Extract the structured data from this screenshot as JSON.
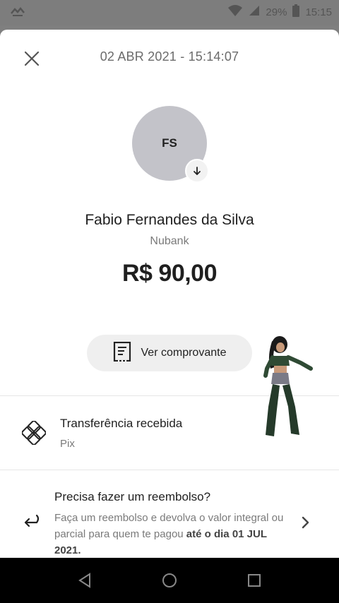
{
  "status_bar": {
    "battery_text": "29%",
    "time": "15:15",
    "icons": [
      "notification-icon",
      "wifi-icon",
      "signal-icon",
      "battery-icon"
    ]
  },
  "header": {
    "datetime": "02 ABR 2021 - 15:14:07",
    "close_icon": "close-icon"
  },
  "contact": {
    "initials": "FS",
    "name": "Fabio Fernandes da Silva",
    "bank": "Nubank",
    "amount": "R$ 90,00",
    "badge_icon": "arrow-down-icon"
  },
  "actions": {
    "receipt_label": "Ver comprovante",
    "receipt_icon": "receipt-icon"
  },
  "transfer": {
    "title": "Transferência recebida",
    "subtitle": "Pix",
    "icon": "pix-icon"
  },
  "refund": {
    "title": "Precisa fazer um reembolso?",
    "body_prefix": "Faça um reembolso e devolva o valor integral ou parcial para quem te pagou ",
    "body_bold": "até o dia 01 JUL 2021.",
    "icon": "return-arrow-icon",
    "chevron_icon": "chevron-right-icon"
  },
  "navigation": {
    "icons": [
      "back-icon",
      "home-icon",
      "recents-icon"
    ]
  },
  "colors": {
    "background_dim": "#7f7f7f",
    "sheet": "#ffffff",
    "avatar": "#c3c3c9",
    "button": "#efefef",
    "nav_bar": "#000000"
  }
}
